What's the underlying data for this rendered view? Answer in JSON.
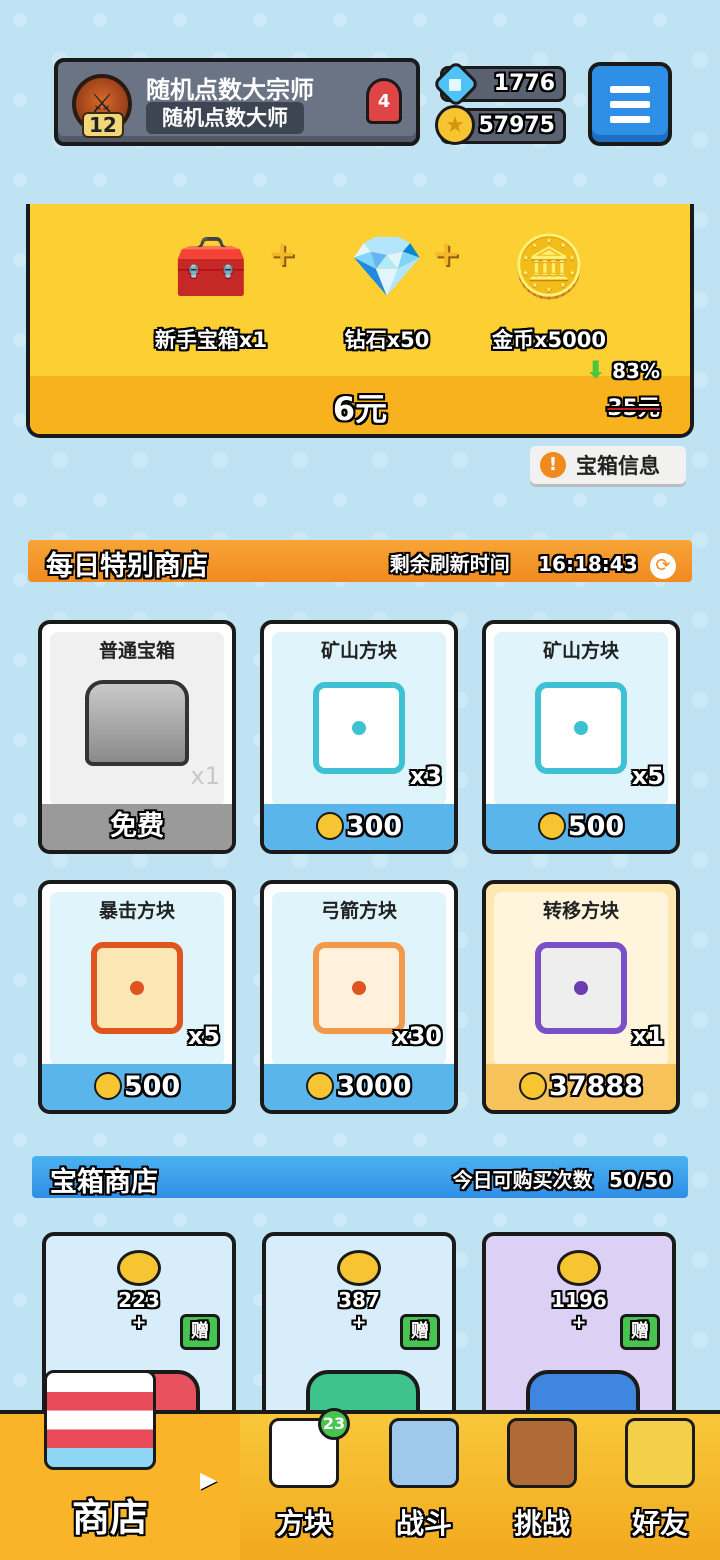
{
  "profile": {
    "level": "12",
    "title": "随机点数大宗师",
    "rank": "随机点数大师",
    "medal_number": "4"
  },
  "currency": {
    "gems": "1776",
    "coins": "57975"
  },
  "starter_pack": {
    "items": [
      {
        "label": "新手宝箱x1"
      },
      {
        "label": "钻石x50"
      },
      {
        "label": "金币x5000"
      }
    ],
    "plus": "+",
    "price": "6元",
    "discount": "83%",
    "original_price": "35元"
  },
  "chest_info_button": "宝箱信息",
  "daily_shop": {
    "title": "每日特别商店",
    "refresh_label": "剩余刷新时间",
    "refresh_time": "16:18:43",
    "cards": [
      {
        "name": "普通宝箱",
        "qty": "x1",
        "price": "免费",
        "theme": "gray"
      },
      {
        "name": "矿山方块",
        "qty": "x3",
        "price": "300",
        "theme": "blue"
      },
      {
        "name": "矿山方块",
        "qty": "x5",
        "price": "500",
        "theme": "blue"
      },
      {
        "name": "暴击方块",
        "qty": "x5",
        "price": "500",
        "theme": "blue"
      },
      {
        "name": "弓箭方块",
        "qty": "x30",
        "price": "3000",
        "theme": "blue"
      },
      {
        "name": "转移方块",
        "qty": "x1",
        "price": "37888",
        "theme": "gold"
      }
    ]
  },
  "chest_shop": {
    "title": "宝箱商店",
    "purchases_label": "今日可购买次数",
    "purchases_value": "50/50",
    "cards": [
      {
        "coins": "223",
        "plus": "+",
        "gift": "赠",
        "color": "#e8525e"
      },
      {
        "coins": "387",
        "plus": "+",
        "gift": "赠",
        "color": "#3fc38d"
      },
      {
        "coins": "1196",
        "plus": "+",
        "gift": "赠",
        "color": "#3f86e0"
      }
    ]
  },
  "nav": {
    "shop": "商店",
    "dice": "方块",
    "dice_badge": "23",
    "battle": "战斗",
    "challenge": "挑战",
    "friends": "好友"
  }
}
